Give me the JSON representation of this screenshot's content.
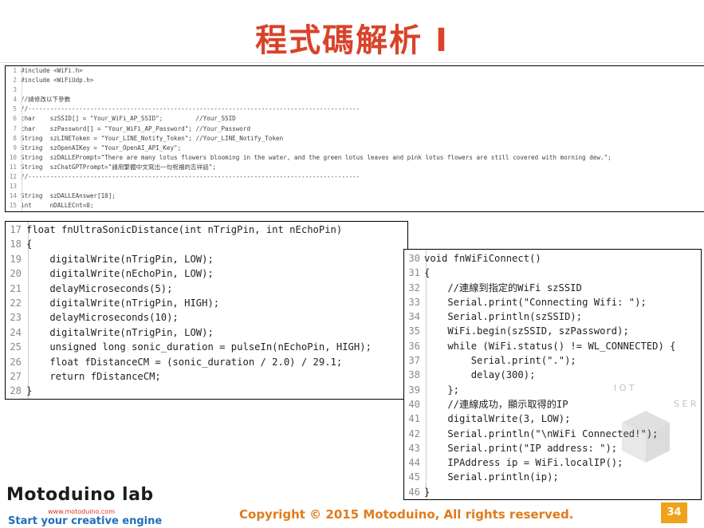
{
  "slide": {
    "title": "程式碼解析 I",
    "copyright": "Copyright © 2015 Motoduino, All rights reserved.",
    "page_number": "34",
    "logo_text": "Motoduino lab",
    "logo_url": "www.motoduino.com",
    "logo_tagline": "Start your creative engine",
    "watermark_text": "IOT SERVICE"
  },
  "code_top": [
    {
      "n": "1",
      "t": "#include <WiFi.h>"
    },
    {
      "n": "2",
      "t": "#include <WiFiUdp.h>"
    },
    {
      "n": "3",
      "t": ""
    },
    {
      "n": "4",
      "t": "//請修改以下參數"
    },
    {
      "n": "5",
      "t": "//-------------------------------------------------------------------------------------------"
    },
    {
      "n": "6",
      "t": "char    szSSID[] = \"Your_WiFi_AP_SSID\";         //Your_SSID"
    },
    {
      "n": "7",
      "t": "char    szPassword[] = \"Your_WiFi_AP_Password\"; //Your_Password"
    },
    {
      "n": "8",
      "t": "String  szLINEToken = \"Your_LINE_Notify_Token\"; //Your_LINE_Notify_Token"
    },
    {
      "n": "9",
      "t": "String  szOpenAIKey = \"Your_OpenAI_API_Key\";"
    },
    {
      "n": "10",
      "t": "String  szDALLEPrompt=\"There are many lotus flowers blooming in the water, and the green lotus leaves and pink lotus flowers are still covered with morning dew.\";"
    },
    {
      "n": "11",
      "t": "String  szChatGPTPrompt=\"請用繁體中文寫出一句祝福的吉祥話\";"
    },
    {
      "n": "12",
      "t": "//-------------------------------------------------------------------------------------------"
    },
    {
      "n": "13",
      "t": ""
    },
    {
      "n": "14",
      "t": "String  szDALLEAnswer[10];"
    },
    {
      "n": "15",
      "t": "int     nDALLECnt=0;"
    }
  ],
  "code_left": [
    {
      "n": "17",
      "t": "float fnUltraSonicDistance(int nTrigPin, int nEchoPin)"
    },
    {
      "n": "18",
      "t": "{"
    },
    {
      "n": "19",
      "t": "    digitalWrite(nTrigPin, LOW);"
    },
    {
      "n": "20",
      "t": "    digitalWrite(nEchoPin, LOW);"
    },
    {
      "n": "21",
      "t": "    delayMicroseconds(5);"
    },
    {
      "n": "22",
      "t": "    digitalWrite(nTrigPin, HIGH);"
    },
    {
      "n": "23",
      "t": "    delayMicroseconds(10);"
    },
    {
      "n": "24",
      "t": "    digitalWrite(nTrigPin, LOW);"
    },
    {
      "n": "25",
      "t": "    unsigned long sonic_duration = pulseIn(nEchoPin, HIGH);"
    },
    {
      "n": "26",
      "t": "    float fDistanceCM = (sonic_duration / 2.0) / 29.1;"
    },
    {
      "n": "27",
      "t": "    return fDistanceCM;"
    },
    {
      "n": "28",
      "t": "}"
    }
  ],
  "code_right": [
    {
      "n": "30",
      "t": "void fnWiFiConnect()"
    },
    {
      "n": "31",
      "t": "{"
    },
    {
      "n": "32",
      "t": "    //連線到指定的WiFi szSSID"
    },
    {
      "n": "33",
      "t": "    Serial.print(\"Connecting Wifi: \");"
    },
    {
      "n": "34",
      "t": "    Serial.println(szSSID);"
    },
    {
      "n": "35",
      "t": "    WiFi.begin(szSSID, szPassword);"
    },
    {
      "n": "36",
      "t": "    while (WiFi.status() != WL_CONNECTED) {"
    },
    {
      "n": "37",
      "t": "        Serial.print(\".\");"
    },
    {
      "n": "38",
      "t": "        delay(300);"
    },
    {
      "n": "39",
      "t": "    };"
    },
    {
      "n": "40",
      "t": "    //連線成功，顯示取得的IP"
    },
    {
      "n": "41",
      "t": "    digitalWrite(3, LOW);"
    },
    {
      "n": "42",
      "t": "    Serial.println(\"\\nWiFi Connected!\");"
    },
    {
      "n": "43",
      "t": "    Serial.print(\"IP address: \");"
    },
    {
      "n": "44",
      "t": "    IPAddress ip = WiFi.localIP();"
    },
    {
      "n": "45",
      "t": "    Serial.println(ip);"
    },
    {
      "n": "46",
      "t": "}"
    }
  ]
}
